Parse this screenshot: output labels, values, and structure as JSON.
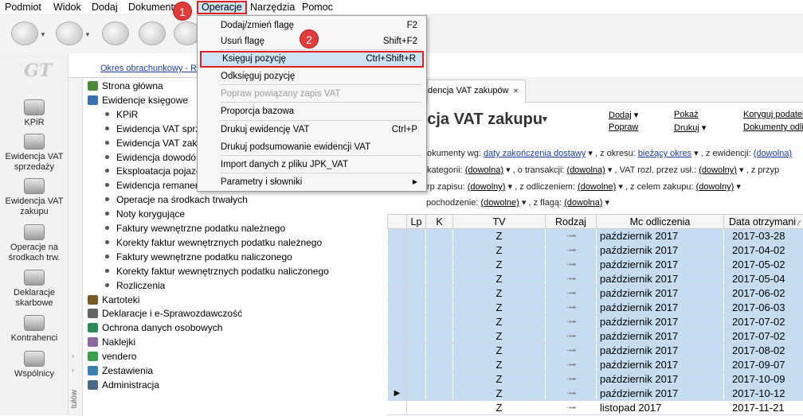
{
  "menubar": {
    "items": [
      "Podmiot",
      "Widok",
      "Dodaj",
      "Dokumenty",
      "Operacje",
      "Narzędzia",
      "Pomoc"
    ]
  },
  "badges": [
    "1",
    "2"
  ],
  "leftnav": {
    "logo": "GT",
    "buttons": [
      "KPiR",
      "Ewidencja VAT sprzedaży",
      "Ewidencja VAT zakupu",
      "Operacje na środkach trw.",
      "Deklaracje skarbowe",
      "Kontrahenci",
      "Wspólnicy"
    ]
  },
  "period_link": "Okres obrachunkowy - Ro",
  "tree": {
    "strip_label": "tułów",
    "items": [
      {
        "label": "Strona główna",
        "level": 0,
        "icon": "house-icon"
      },
      {
        "label": "Ewidencje księgowe",
        "level": 0,
        "icon": "ledger-icon"
      },
      {
        "label": "KPiR",
        "level": 1
      },
      {
        "label": "Ewidencja VAT sprz",
        "level": 1
      },
      {
        "label": "Ewidencja VAT zaku",
        "level": 1
      },
      {
        "label": "Ewidencja dowodó",
        "level": 1
      },
      {
        "label": "Eksploatacja pojazc",
        "level": 1
      },
      {
        "label": "Ewidencja remaner",
        "level": 1
      },
      {
        "label": "Operacje na środkach trwałych",
        "level": 1
      },
      {
        "label": "Noty korygujące",
        "level": 1
      },
      {
        "label": "Faktury wewnętrzne podatku należnego",
        "level": 1
      },
      {
        "label": "Korekty faktur wewnętrznych podatku należnego",
        "level": 1
      },
      {
        "label": "Faktury wewnętrzne podatku naliczonego",
        "level": 1
      },
      {
        "label": "Korekty faktur wewnętrznych podatku naliczonego",
        "level": 1
      },
      {
        "label": "Rozliczenia",
        "level": 1
      },
      {
        "label": "Kartoteki",
        "level": 0,
        "icon": "cards-icon"
      },
      {
        "label": "Deklaracje i e-Sprawozdawczość",
        "level": 0,
        "icon": "declaration-icon"
      },
      {
        "label": "Ochrona danych osobowych",
        "level": 0,
        "icon": "shield-icon"
      },
      {
        "label": "Naklejki",
        "level": 0,
        "icon": "sticker-icon"
      },
      {
        "label": "vendero",
        "level": 0,
        "icon": "vendero-icon"
      },
      {
        "label": "Zestawienia",
        "level": 0,
        "icon": "chart-icon"
      },
      {
        "label": "Administracja",
        "level": 0,
        "icon": "admin-icon"
      }
    ]
  },
  "tab": {
    "label": "dencja VAT zakupów",
    "close": "×"
  },
  "content": {
    "title": "ncja VAT zakupu",
    "actions": {
      "dodaj": "Dodaj",
      "poprawa": "Popraw",
      "pokaz": "Pokaż",
      "drukuj": "Drukuj",
      "koryguj": "Koryguj podatek",
      "dokumenty": "Dokumenty odliczeń"
    },
    "filters": {
      "row1": {
        "l1": "okumenty wg:",
        "v1": "daty zakończenia dostawy",
        "l2": ", z okresu:",
        "v2": "bieżący okres",
        "l3": ", z ewidencji:",
        "v3": "(dowolna)"
      },
      "row2": {
        "l1": "kategorii:",
        "v1": "(dowolna)",
        "l2": ", o transakcji:",
        "v2": "(dowolna)",
        "l3": ", VAT rozl. przez usł.:",
        "v3": "(dowolny)",
        "l4": ", z przyp"
      },
      "row3": {
        "l1": "rp zapisu:",
        "v1": "(dowolny)",
        "l2": ", z odliczeniem:",
        "v2": "(dowolne)",
        "l3": ", z celem zakupu:",
        "v3": "(dowolny)"
      },
      "row4": {
        "l1": "pochodzenie:",
        "v1": "(dowolne)",
        "l2": ", z flagą:",
        "v2": "(dowolna)"
      }
    }
  },
  "grid": {
    "columns": [
      "",
      "Lp",
      "K",
      "TV",
      "Rodzaj",
      "Mc odliczenia",
      "Data otrzymani"
    ],
    "rows": [
      {
        "tv": "Z",
        "rodzaj": "⇢↠",
        "mc": "październik 2017",
        "data": "2017-03-28",
        "selected": true
      },
      {
        "tv": "Z",
        "rodzaj": "⇢↠",
        "mc": "październik 2017",
        "data": "2017-04-02",
        "selected": true
      },
      {
        "tv": "Z",
        "rodzaj": "⇢↠",
        "mc": "październik 2017",
        "data": "2017-05-02",
        "selected": true
      },
      {
        "tv": "Z",
        "rodzaj": "⇢↠",
        "mc": "październik 2017",
        "data": "2017-05-04",
        "selected": true
      },
      {
        "tv": "Z",
        "rodzaj": "⇢↠",
        "mc": "październik 2017",
        "data": "2017-06-02",
        "selected": true
      },
      {
        "tv": "Z",
        "rodzaj": "⇢↠",
        "mc": "październik 2017",
        "data": "2017-06-03",
        "selected": true
      },
      {
        "tv": "Z",
        "rodzaj": "⇢↠",
        "mc": "październik 2017",
        "data": "2017-07-02",
        "selected": true
      },
      {
        "tv": "Z",
        "rodzaj": "⇢↠",
        "mc": "październik 2017",
        "data": "2017-07-02",
        "selected": true
      },
      {
        "tv": "Z",
        "rodzaj": "⇢↠",
        "mc": "październik 2017",
        "data": "2017-08-02",
        "selected": true
      },
      {
        "tv": "Z",
        "rodzaj": "⇢↠",
        "mc": "październik 2017",
        "data": "2017-09-07",
        "selected": true
      },
      {
        "tv": "Z",
        "rodzaj": "⇢↠",
        "mc": "październik 2017",
        "data": "2017-10-09",
        "selected": true
      },
      {
        "tv": "Z",
        "rodzaj": "⇢↠",
        "mc": "październik 2017",
        "data": "2017-10-12",
        "selected": true,
        "current": true
      },
      {
        "tv": "Z",
        "rodzaj": "⇢↠",
        "mc": "listopad 2017",
        "data": "2017-11-21",
        "selected": false
      }
    ]
  },
  "dropdown": {
    "items": [
      {
        "label": "Dodaj/zmień flagę",
        "shortcut": "F2"
      },
      {
        "label": "Usuń flagę",
        "shortcut": "Shift+F2"
      },
      {
        "label": "Księguj pozycję",
        "shortcut": "Ctrl+Shift+R",
        "highlight": true
      },
      {
        "label": "Odksięguj pozycję",
        "shortcut": ""
      },
      {
        "label": "Popraw powiązany zapis VAT",
        "shortcut": "",
        "disabled": true
      },
      {
        "label": "Proporcja bazowa",
        "shortcut": ""
      },
      {
        "label": "Drukuj ewidencję VAT",
        "shortcut": "Ctrl+P"
      },
      {
        "label": "Drukuj podsumowanie ewidencji VAT",
        "shortcut": ""
      },
      {
        "label": "Import danych z pliku JPK_VAT",
        "shortcut": ""
      },
      {
        "label": "Parametry i słowniki",
        "shortcut": "",
        "submenu": true
      }
    ]
  }
}
